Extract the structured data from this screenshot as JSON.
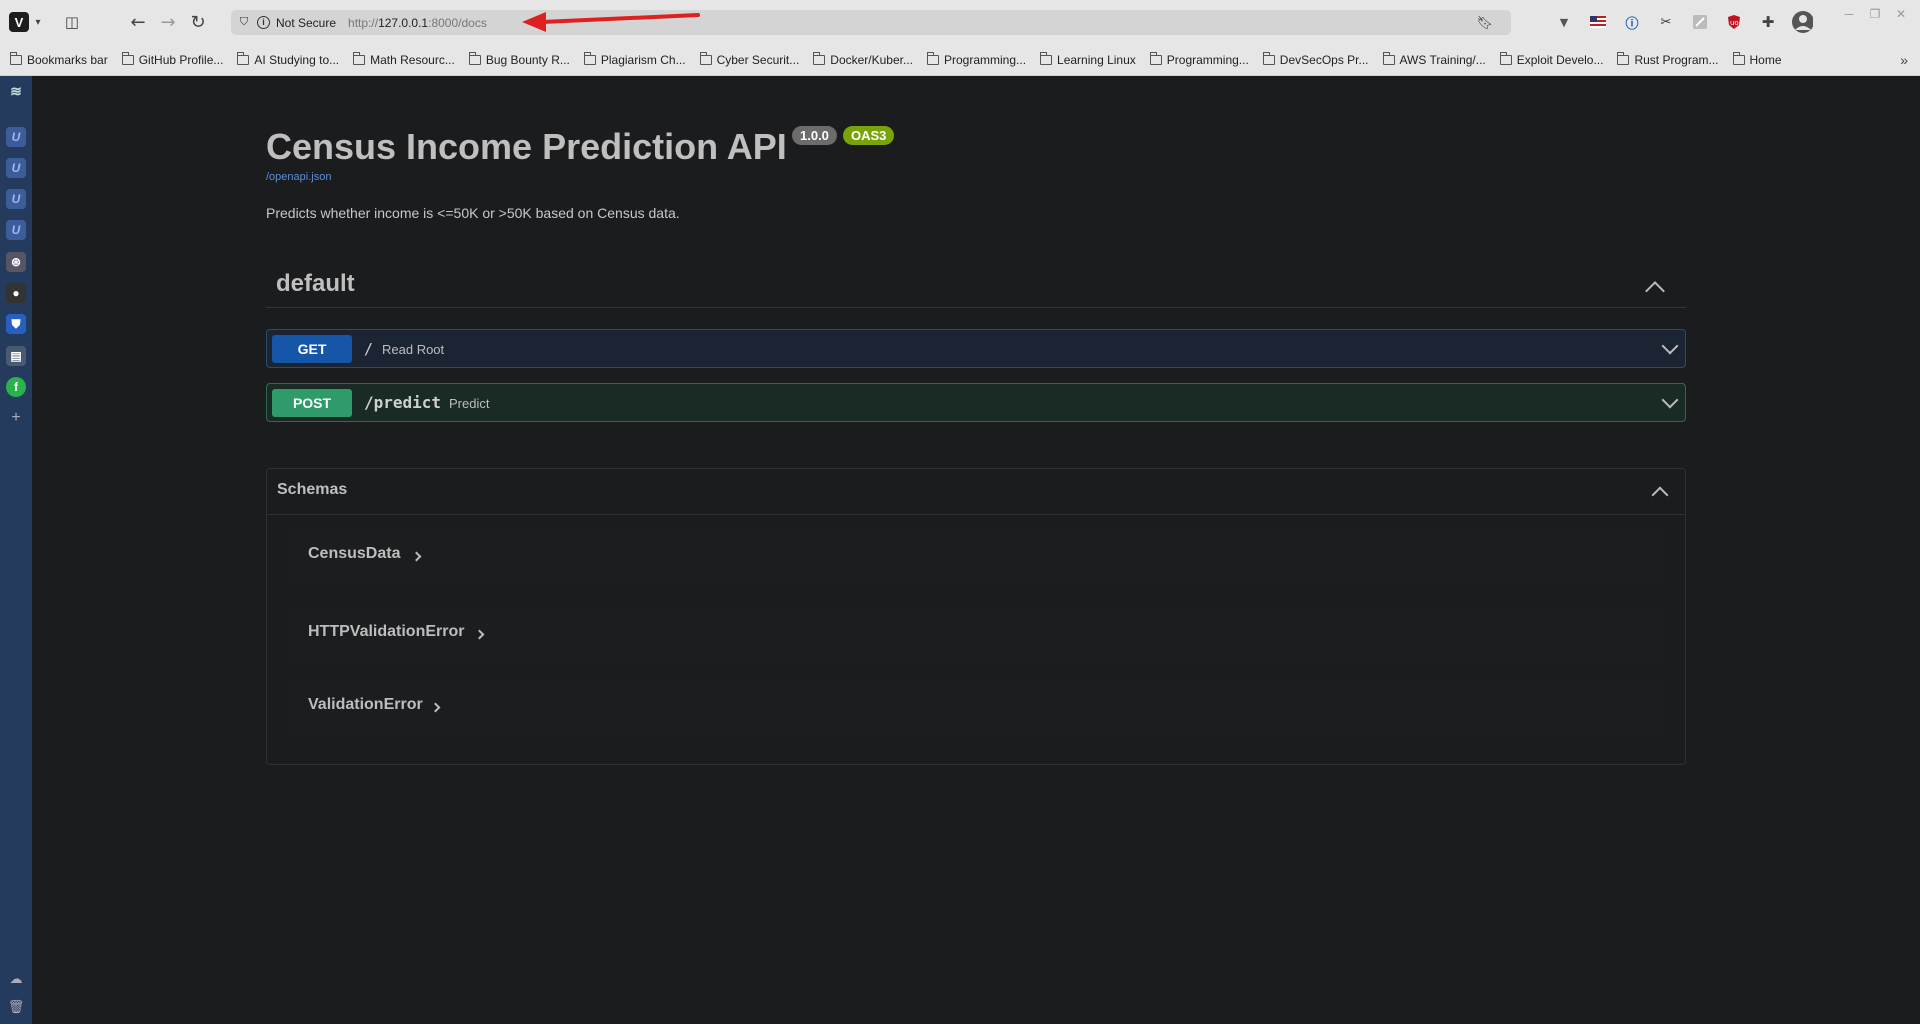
{
  "browser": {
    "not_secure": "Not Secure",
    "url_prefix": "http://",
    "url_host": "127.0.0.1",
    "url_rest": ":8000/docs",
    "bookmarks": [
      "Bookmarks bar",
      "GitHub Profile...",
      "AI Studying to...",
      "Math Resourc...",
      "Bug Bounty R...",
      "Plagiarism Ch...",
      "Cyber Securit...",
      "Docker/Kuber...",
      "Programming...",
      "Learning Linux",
      "Programming...",
      "DevSecOps Pr...",
      "AWS Training/...",
      "Exploit Develo...",
      "Rust Program...",
      "Home"
    ],
    "annotation_color": "#e02020"
  },
  "api": {
    "title": "Census Income Prediction API",
    "version": "1.0.0",
    "oas": "OAS3",
    "spec_link": "/openapi.json",
    "description": "Predicts whether income is <=50K or >50K based on Census data."
  },
  "tag": {
    "name": "default"
  },
  "operations": [
    {
      "method": "GET",
      "path": "/",
      "summary": "Read Root",
      "color": "#1556a8"
    },
    {
      "method": "POST",
      "path": "/predict",
      "summary": "Predict",
      "color": "#2f9b6a"
    }
  ],
  "schemas": {
    "title": "Schemas",
    "models": [
      "CensusData",
      "HTTPValidationError",
      "ValidationError"
    ]
  }
}
